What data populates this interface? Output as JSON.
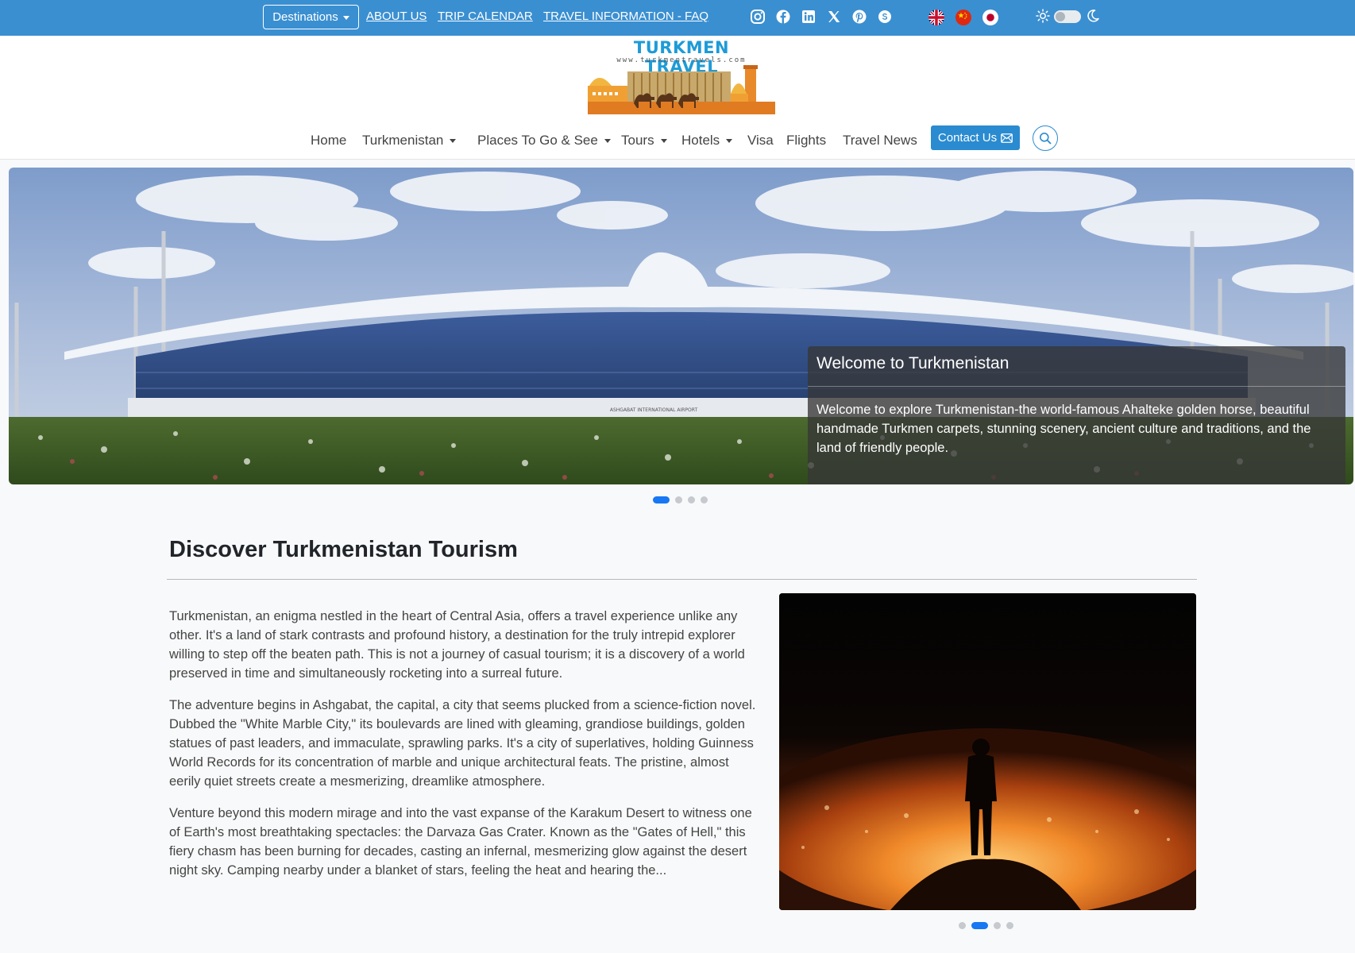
{
  "topbar": {
    "destinations_label": "Destinations",
    "links": [
      "ABOUT US",
      "TRIP CALENDAR",
      "TRAVEL INFORMATION - FAQ"
    ],
    "social_icons": [
      "instagram-icon",
      "facebook-icon",
      "linkedin-icon",
      "x-icon",
      "pinterest-icon",
      "skype-icon"
    ],
    "languages": [
      "english-flag-icon",
      "chinese-flag-icon",
      "japanese-flag-icon"
    ]
  },
  "logo": {
    "title": "TURKMEN TRAVEL",
    "url": "www.turkmentravels.com"
  },
  "nav": {
    "items": [
      "Home",
      "Turkmenistan",
      "Places To Go & See",
      "Tours",
      "Hotels",
      "Visa",
      "Flights",
      "Travel News"
    ],
    "contact_label": "Contact Us"
  },
  "hero": {
    "caption_title": "Welcome to Turkmenistan",
    "caption_text": "Welcome to explore Turkmenistan-the world-famous Ahalteke golden horse, beautiful handmade Turkmen carpets, stunning scenery, ancient culture and traditions, and the land of friendly people.",
    "building_sign": "ASHGABAT INTERNATIONAL AIRPORT",
    "slide_count": 4,
    "active_slide": 1
  },
  "discover": {
    "title": "Discover Turkmenistan Tourism",
    "paragraphs": [
      "Turkmenistan, an enigma nestled in the heart of Central Asia, offers a travel experience unlike any other. It's a land of stark contrasts and profound history, a destination for the truly intrepid explorer willing to step off the beaten path. This is not a journey of casual tourism; it is a discovery of a world preserved in time and simultaneously rocketing into a surreal future.",
      "The adventure begins in Ashgabat, the capital, a city that seems plucked from a science-fiction novel. Dubbed the \"White Marble City,\" its boulevards are lined with gleaming, grandiose buildings, golden statues of past leaders, and immaculate, sprawling parks. It's a city of superlatives, holding Guinness World Records for its concentration of marble and unique architectural feats. The pristine, almost eerily quiet streets create a mesmerizing, dreamlike atmosphere.",
      "Venture beyond this modern mirage and into the vast expanse of the Karakum Desert to witness one of Earth's most breathtaking spectacles: the Darvaza Gas Crater. Known as the \"Gates of Hell,\" this fiery chasm has been burning for decades, casting an infernal, mesmerizing glow against the desert night sky. Camping nearby under a blanket of stars, feeling the heat and hearing the..."
    ],
    "image_slide_count": 4,
    "image_active_slide": 2
  },
  "colors": {
    "topbar": "#3a8fd1",
    "accent": "#2a8bd0",
    "active_dot": "#1877f2"
  }
}
